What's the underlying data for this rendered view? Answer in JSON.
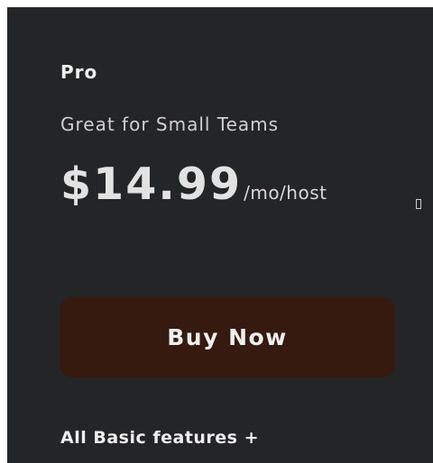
{
  "plan": {
    "name": "Pro",
    "tagline": "Great for Small Teams",
    "price": "$14.99",
    "price_unit": "/mo/host",
    "buy_label": "Buy Now",
    "features_heading": "All Basic features +"
  },
  "colors": {
    "card_background": "#242526",
    "button_background": "#361a0f",
    "text": "#e2e2e2"
  }
}
